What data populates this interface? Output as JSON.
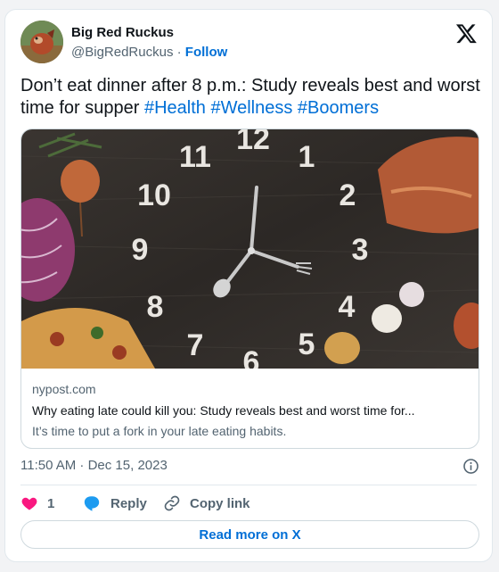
{
  "colors": {
    "link_blue": "#006fd6",
    "heart_pink": "#f91880",
    "reply_blue": "#1d9bf0",
    "secondary_text": "#536471"
  },
  "author": {
    "name": "Big Red Ruckus",
    "handle": "@BigRedRuckus",
    "separator": "·",
    "follow_label": "Follow",
    "avatar_icon": "profile-photo"
  },
  "platform_icon": "x-logo-icon",
  "tweet": {
    "text": "Don’t eat dinner after 8 p.m.: Study reveals best and worst time for supper",
    "hashtags": [
      "#Health",
      "#Wellness",
      "#Boomers"
    ]
  },
  "link_card": {
    "image_description_icon": "clock-dinner-photo",
    "clock_numbers": [
      "12",
      "1",
      "2",
      "3",
      "4",
      "5",
      "6",
      "7",
      "8",
      "9",
      "10",
      "11"
    ],
    "domain": "nypost.com",
    "title": "Why eating late could kill you: Study reveals best and worst time for...",
    "description": "It’s time to put a fork in your late eating habits."
  },
  "meta": {
    "timestamp": "11:50 AM · Dec 15, 2023",
    "info_icon": "info-icon"
  },
  "actions": {
    "like_count": "1",
    "reply_label": "Reply",
    "copy_link_label": "Copy link"
  },
  "read_more_label": "Read more on X"
}
